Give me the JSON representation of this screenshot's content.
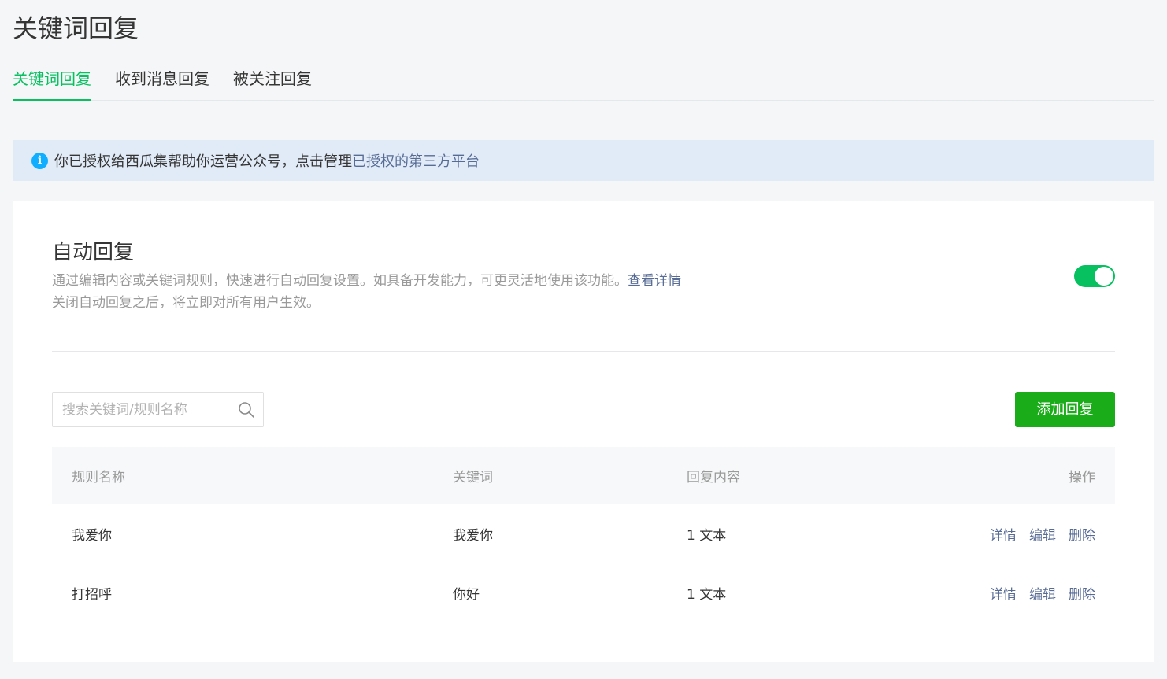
{
  "page_title": "关键词回复",
  "tabs": [
    {
      "label": "关键词回复",
      "active": true
    },
    {
      "label": "收到消息回复",
      "active": false
    },
    {
      "label": "被关注回复",
      "active": false
    }
  ],
  "notice": {
    "text": "你已授权给西瓜集帮助你运营公众号，点击管理",
    "link": "已授权的第三方平台"
  },
  "auto_reply": {
    "title": "自动回复",
    "desc_line1": "通过编辑内容或关键词规则，快速进行自动回复设置。如具备开发能力，可更灵活地使用该功能。",
    "desc_link": "查看详情",
    "desc_line2": "关闭自动回复之后，将立即对所有用户生效。",
    "enabled": true
  },
  "search": {
    "placeholder": "搜索关键词/规则名称",
    "value": ""
  },
  "add_button_label": "添加回复",
  "table": {
    "headers": {
      "name": "规则名称",
      "keyword": "关键词",
      "reply": "回复内容",
      "ops": "操作"
    },
    "rows": [
      {
        "name": "我爱你",
        "keyword": "我爱你",
        "reply": "1 文本",
        "ops": [
          "详情",
          "编辑",
          "删除"
        ]
      },
      {
        "name": "打招呼",
        "keyword": "你好",
        "reply": "1 文本",
        "ops": [
          "详情",
          "编辑",
          "删除"
        ]
      }
    ]
  },
  "colors": {
    "accent": "#07c160",
    "link": "#576b95",
    "button": "#1aad19",
    "notice_bg": "#e1ebf7",
    "info_icon": "#10aeff"
  },
  "icons": {
    "notice": "info-icon",
    "search": "search-icon"
  }
}
